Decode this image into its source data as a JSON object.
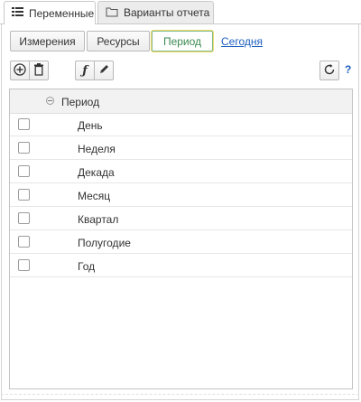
{
  "tabs": {
    "variables": "Переменные",
    "report_variants": "Варианты отчета"
  },
  "filters": {
    "dimensions": "Измерения",
    "resources": "Ресурсы",
    "period": "Период",
    "today": "Сегодня"
  },
  "toolbar": {
    "help": "?"
  },
  "grid": {
    "group_label": "Период",
    "rows": [
      "День",
      "Неделя",
      "Декада",
      "Месяц",
      "Квартал",
      "Полугодие",
      "Год"
    ]
  },
  "colors": {
    "link": "#1f5fbf",
    "active_green": "#3a8a4f",
    "active_outline": "#f1d86a"
  }
}
